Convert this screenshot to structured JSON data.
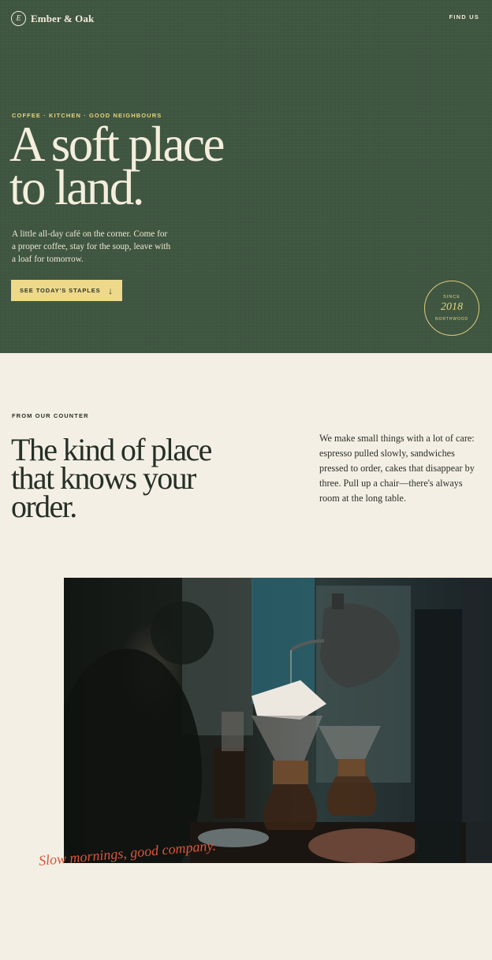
{
  "brand": {
    "mark": "E",
    "name": "Ember & Oak"
  },
  "nav": {
    "find_us": "FIND US"
  },
  "hero": {
    "eyebrow": "COFFEE · KITCHEN · GOOD NEIGHBOURS",
    "title_line1": "A soft place",
    "title_line2": "to land.",
    "body": "A little all-day café on the corner. Come for a proper coffee, stay for the soup, leave with a loaf for tomorrow.",
    "cta_label": "SEE TODAY'S STAPLES",
    "cta_arrow": "↓"
  },
  "badge": {
    "since": "SINCE",
    "year": "2018",
    "place": "NORTHWOOD"
  },
  "counter": {
    "label": "FROM OUR COUNTER",
    "title_line1": "The kind of place",
    "title_line2": "that knows your",
    "title_line3": "order.",
    "body": "We make small things with a lot of care: espresso pulled slowly, sandwiches pressed to order, cakes that disappear by three. Pull up a chair—there's always room at the long table."
  },
  "caption": "Slow mornings, good company.",
  "colors": {
    "hero_green": "#3f5641",
    "cream": "#f4efe4",
    "accent_yellow": "#eed98a",
    "accent_orange": "#d9553a"
  }
}
